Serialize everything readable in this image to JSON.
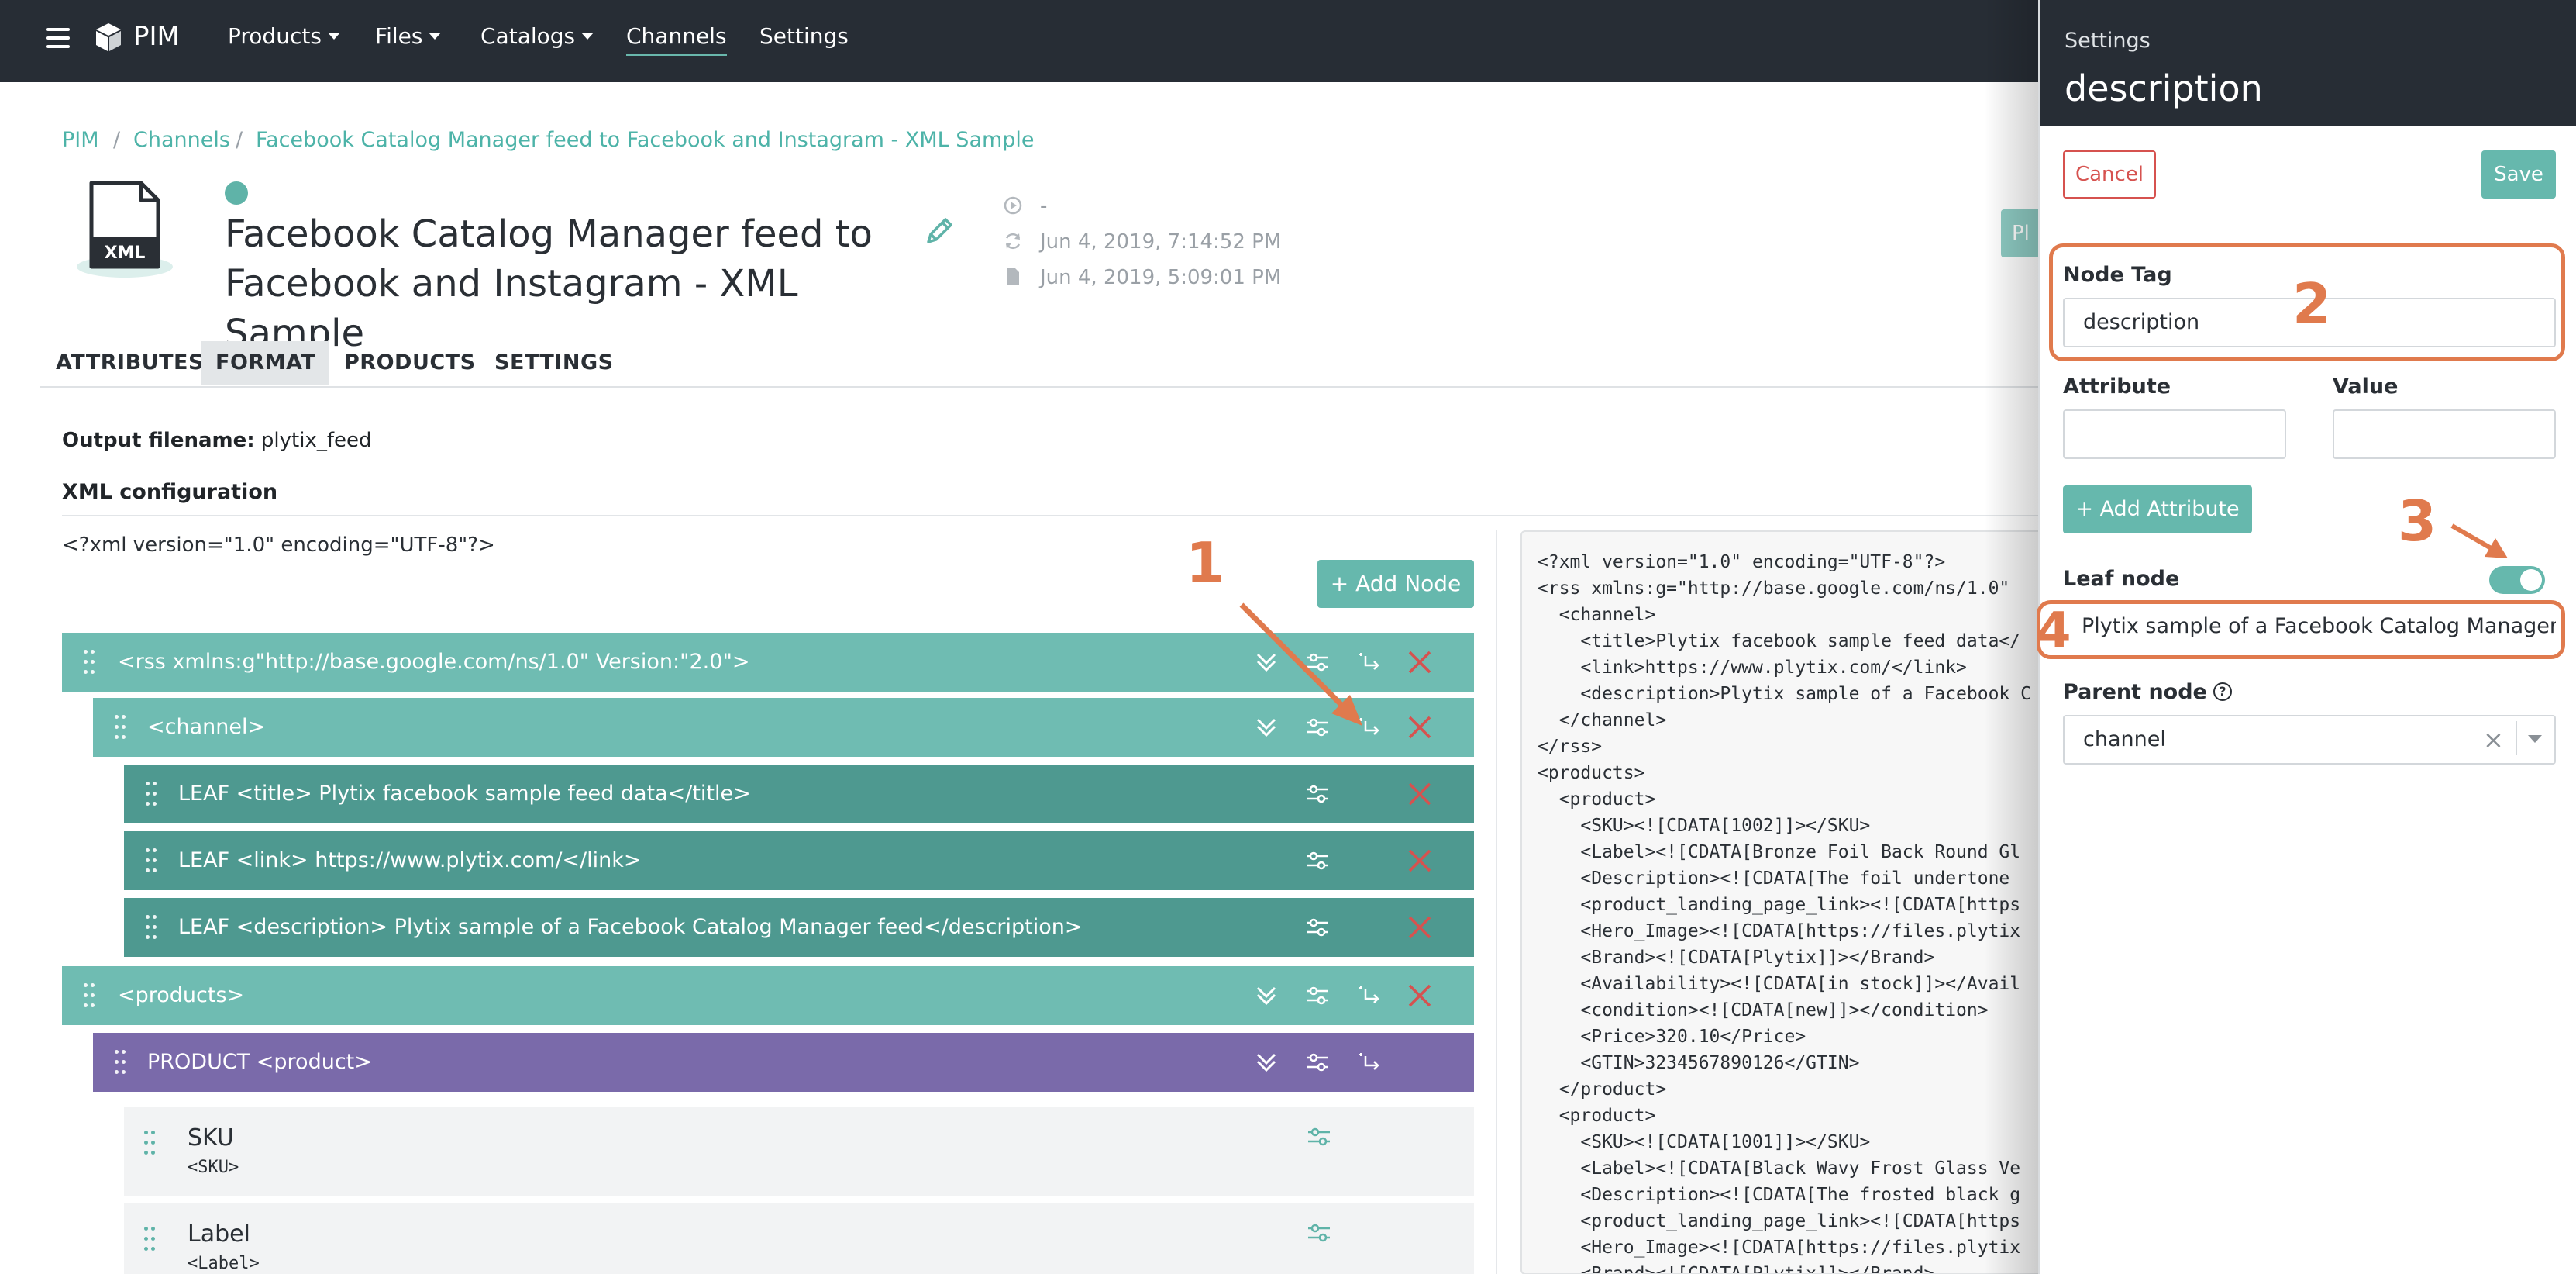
{
  "nav": {
    "brand": "PIM",
    "items": [
      {
        "label": "Products",
        "dropdown": true
      },
      {
        "label": "Files",
        "dropdown": true
      },
      {
        "label": "Catalogs",
        "dropdown": true
      },
      {
        "label": "Channels",
        "dropdown": false,
        "active": true
      },
      {
        "label": "Settings",
        "dropdown": false
      }
    ]
  },
  "breadcrumb": [
    "PIM",
    "Channels",
    "Facebook Catalog Manager feed to Facebook and Instagram - XML Sample"
  ],
  "header": {
    "file_icon_label": "XML",
    "title": "Facebook Catalog Manager feed to Facebook and Instagram - XML Sample",
    "meta": {
      "run": "-",
      "updated": "Jun 4, 2019, 7:14:52 PM",
      "created": "Jun 4, 2019, 5:09:01 PM"
    },
    "peek_button": "Pl"
  },
  "tabs": [
    {
      "label": "ATTRIBUTES",
      "active": false
    },
    {
      "label": "FORMAT",
      "active": true
    },
    {
      "label": "PRODUCTS",
      "active": false
    },
    {
      "label": "SETTINGS",
      "active": false
    }
  ],
  "format": {
    "output_label": "Output filename:",
    "output_value": "plytix_feed",
    "xml_config_label": "XML configuration",
    "xml_declaration": "<?xml version=\"1.0\" encoding=\"UTF-8\"?>",
    "add_node_label": "+ Add Node",
    "nodes": {
      "rss": "<rss xmlns:g\"http://base.google.com/ns/1.0\" Version:\"2.0\">",
      "channel": "<channel>",
      "leaf_title": "LEAF <title> Plytix facebook sample feed data</title>",
      "leaf_link": "LEAF <link> https://www.plytix.com/</link>",
      "leaf_description": "LEAF <description> Plytix sample of a Facebook Catalog Manager feed</description>",
      "products": "<products>",
      "product": "PRODUCT <product>"
    },
    "fields": [
      {
        "name": "SKU",
        "tag": "<SKU>"
      },
      {
        "name": "Label",
        "tag": "<Label>"
      }
    ]
  },
  "preview_lines": [
    "<?xml version=\"1.0\" encoding=\"UTF-8\"?>",
    "<rss xmlns:g=\"http://base.google.com/ns/1.0\" ",
    "  <channel>",
    "    <title>Plytix facebook sample feed data</",
    "    <link>https://www.plytix.com/</link>",
    "    <description>Plytix sample of a Facebook C",
    "  </channel>",
    "</rss>",
    "<products>",
    "  <product>",
    "    <SKU><![CDATA[1002]]></SKU>",
    "    <Label><![CDATA[Bronze Foil Back Round Gl",
    "    <Description><![CDATA[The foil undertone ",
    "    <product_landing_page_link><![CDATA[https",
    "    <Hero_Image><![CDATA[https://files.plytix",
    "    <Brand><![CDATA[Plytix]]></Brand>",
    "    <Availability><![CDATA[in stock]]></Avail",
    "    <condition><![CDATA[new]]></condition>",
    "    <Price>320.10</Price>",
    "    <GTIN>3234567890126</GTIN>",
    "  </product>",
    "  <product>",
    "    <SKU><![CDATA[1001]]></SKU>",
    "    <Label><![CDATA[Black Wavy Frost Glass Ve",
    "    <Description><![CDATA[The frosted black g",
    "    <product_landing_page_link><![CDATA[https",
    "    <Hero_Image><![CDATA[https://files.plytix",
    "    <Brand><![CDATA[Plytix]]></Brand>"
  ],
  "annotations": [
    "1",
    "2",
    "3",
    "4"
  ],
  "panel": {
    "subtitle": "Settings",
    "title": "description",
    "cancel_label": "Cancel",
    "save_label": "Save",
    "node_tag_label": "Node Tag",
    "node_tag_value": "description",
    "attribute_label": "Attribute",
    "attribute_value": "",
    "value_label": "Value",
    "value_value": "",
    "add_attribute_label": "+ Add Attribute",
    "leaf_node_label": "Leaf node",
    "leaf_node_on": true,
    "leaf_value": "Plytix sample of a Facebook Catalog Manager fe",
    "parent_node_label": "Parent node",
    "parent_node_value": "channel"
  },
  "colors": {
    "navbar": "#272d35",
    "accent": "#66b8ad",
    "node_teal": "#6fbcb2",
    "leaf_teal": "#4e9990",
    "product_purple": "#7a6aaa",
    "delete_red": "#d6524f",
    "annotation_orange": "#e07a4d"
  }
}
